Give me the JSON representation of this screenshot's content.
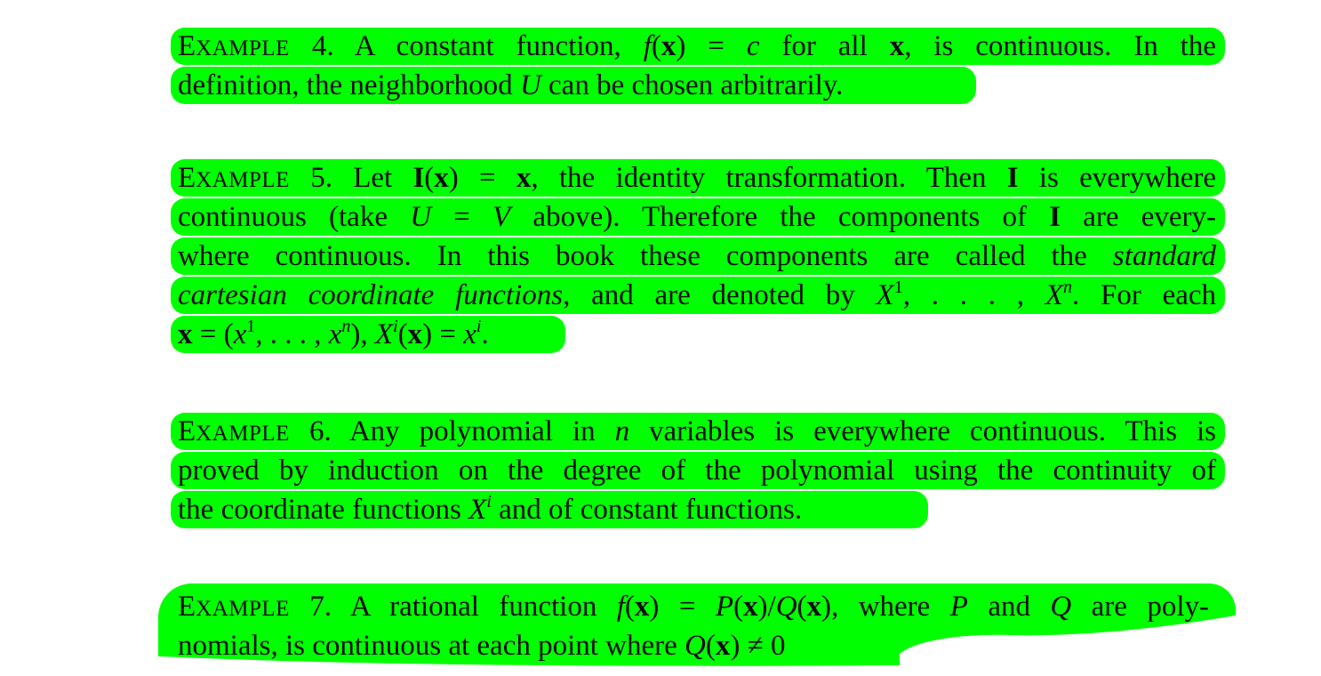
{
  "examples": [
    {
      "label_first": "E",
      "label_rest": "XAMPLE",
      "number": "4.",
      "lines": {
        "l1a": "A constant function, ",
        "l1f": "f",
        "l1b": "(",
        "l1x": "x",
        "l1c": ") = ",
        "l1const": "c",
        "l1d": " for all ",
        "l1x2": "x",
        "l1e": ", is continuous. In the",
        "l2a": "definition, the neighborhood ",
        "l2U": "U",
        "l2b": " can be chosen arbitrarily."
      }
    },
    {
      "label_first": "E",
      "label_rest": "XAMPLE",
      "number": "5.",
      "lines": {
        "l1a": "Let ",
        "l1I": "I",
        "l1b": "(",
        "l1x": "x",
        "l1c": ") = ",
        "l1x2": "x",
        "l1d": ", the identity transformation. Then ",
        "l1I2": "I",
        "l1e": " is everywhere",
        "l2a": "continuous (take ",
        "l2U": "U",
        "l2b": " = ",
        "l2V": "V",
        "l2c": " above). Therefore the components of ",
        "l2I": "I",
        "l2d": " are every-",
        "l3a": "where continuous. In this book these components are called the ",
        "l3it": "standard",
        "l4it": "cartesian coordinate functions",
        "l4a": ", and are denoted by ",
        "l4X1": "X",
        "l4sup1": "1",
        "l4b": ", . . . , ",
        "l4Xn": "X",
        "l4supn": "n",
        "l4c": ". For each",
        "l5x": "x",
        "l5a": " = (",
        "l5x1": "x",
        "l5sup1": "1",
        "l5b": ", . . . , ",
        "l5xn": "x",
        "l5supn": "n",
        "l5c": "), ",
        "l5Xi": "X",
        "l5supi": "i",
        "l5d": "(",
        "l5x2": "x",
        "l5e": ") = ",
        "l5xi": "x",
        "l5supi2": "i",
        "l5f": "."
      }
    },
    {
      "label_first": "E",
      "label_rest": "XAMPLE",
      "number": "6.",
      "lines": {
        "l1a": "Any polynomial in ",
        "l1n": "n",
        "l1b": " variables is everywhere continuous. This is",
        "l2a": "proved by induction on the degree of the polynomial using the continuity of",
        "l3a": "the coordinate functions ",
        "l3X": "X",
        "l3sup": "i",
        "l3b": " and of constant functions."
      }
    },
    {
      "label_first": "E",
      "label_rest": "XAMPLE",
      "number": "7.",
      "lines": {
        "l1a": "A rational function ",
        "l1f": "f",
        "l1b": "(",
        "l1x": "x",
        "l1c": ") = ",
        "l1P": "P",
        "l1d": "(",
        "l1x2": "x",
        "l1e": ")/",
        "l1Q": "Q",
        "l1g": "(",
        "l1x3": "x",
        "l1h": "), where ",
        "l1P2": "P",
        "l1i": " and ",
        "l1Q2": "Q",
        "l1j": " are poly-",
        "l2a": "nomials, is continuous at each point where ",
        "l2Q": "Q",
        "l2b": "(",
        "l2x": "x",
        "l2c": ") ≠ 0"
      }
    }
  ],
  "colors": {
    "highlight": "#00ff00",
    "text": "#0a0a0a",
    "background": "#ffffff"
  }
}
